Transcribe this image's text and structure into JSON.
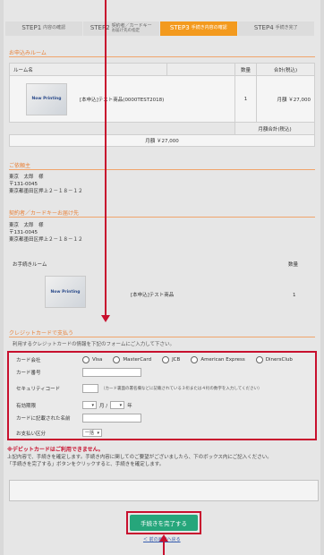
{
  "steps": [
    {
      "num": "STEP1",
      "label": "内容の確認"
    },
    {
      "num": "STEP2",
      "label": "契約者／カードキー",
      "sub": "お届け先の指定"
    },
    {
      "num": "STEP3",
      "label": "手続き内容の確認"
    },
    {
      "num": "STEP4",
      "label": "手続き完了"
    }
  ],
  "sections": {
    "order_title": "お申込みルーム",
    "customer_title": "ご依頼主",
    "delivery_title": "契約者／カードキーお届け先",
    "credit_title": "クレジットカードで支払う"
  },
  "order_table": {
    "headers": [
      "ルーム名",
      "",
      "数量",
      "合計(税込)"
    ],
    "thumb_label": "Now Printing",
    "item_name": "[本申込]テスト商品(0000TEST2018)",
    "qty": "1",
    "price": "月額 ￥27,000",
    "monthly_header": "月額合計(税込)",
    "monthly_total": "月額 ￥27,000"
  },
  "customer": {
    "name": "東京　太郎　様",
    "zip": "〒131-0045",
    "address": "東京都墨田区押上２－１８－１２"
  },
  "delivery": {
    "name": "東京　太郎　様",
    "zip": "〒131-0045",
    "address": "東京都墨田区押上２－１８－１２",
    "room_header": "お手続きルーム",
    "qty_header": "数量",
    "thumb_label": "Now Printing",
    "item_name": "[本申込]テスト商品",
    "qty": "1"
  },
  "credit": {
    "instruction": "利用するクレジットカードの情報を下記のフォームにご入力して下さい。",
    "company_label": "カード会社",
    "companies": [
      "Visa",
      "MasterCard",
      "JCB",
      "American Express",
      "DinersClub"
    ],
    "number_label": "カード番号",
    "security_label": "セキュリティコード",
    "security_help": "（カード裏面の署名欄などに記載されている３桁または４桁の数字を入力してください）",
    "expiry_label": "有効期限",
    "expiry_month_sep": "月 /",
    "expiry_year_sep": "年",
    "holder_label": "カードに記載された名前",
    "payment_label": "お支払い区分",
    "payment_value": "一括"
  },
  "debit_note": "※デビットカードはご利用できません。",
  "confirm_text_1": "上記内容で、手続きを確定します。手続き内容に関してのご要望がございましたら、下のボックス内にご記入ください。",
  "confirm_text_2": "「手続きを完了する」ボタンをクリックすると、手続きを確定します。",
  "submit_label": "手続きを完了する",
  "back_label": "＜ 前の画面へ戻る",
  "colors": {
    "accent": "#f39a1e",
    "highlight": "#c8102e",
    "submit": "#26a67b"
  }
}
